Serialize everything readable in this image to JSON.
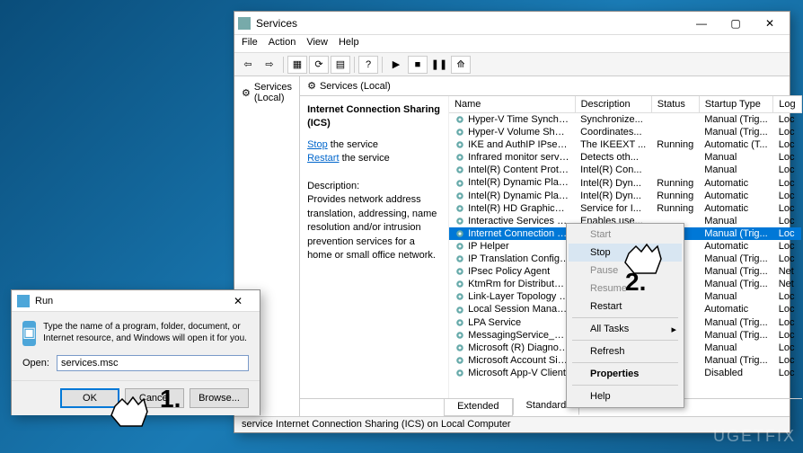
{
  "watermark": "UGETFIX",
  "services_window": {
    "title": "Services",
    "menus": [
      "File",
      "Action",
      "View",
      "Help"
    ],
    "tree_root": "Services (Local)",
    "header": "Services (Local)",
    "detail": {
      "title": "Internet Connection Sharing (ICS)",
      "stop_link": "Stop",
      "stop_rest": " the service",
      "restart_link": "Restart",
      "restart_rest": " the service",
      "desc_label": "Description:",
      "desc_body": "Provides network address translation, addressing, name resolution and/or intrusion prevention services for a home or small office network."
    },
    "columns": [
      "Name",
      "Description",
      "Status",
      "Startup Type",
      "Log"
    ],
    "rows": [
      {
        "name": "Hyper-V Time Synchronizat...",
        "desc": "Synchronize...",
        "status": "",
        "startup": "Manual (Trig...",
        "log": "Loc"
      },
      {
        "name": "Hyper-V Volume Shadow C...",
        "desc": "Coordinates...",
        "status": "",
        "startup": "Manual (Trig...",
        "log": "Loc"
      },
      {
        "name": "IKE and AuthIP IPsec Keying...",
        "desc": "The IKEEXT ...",
        "status": "Running",
        "startup": "Automatic (T...",
        "log": "Loc"
      },
      {
        "name": "Infrared monitor service",
        "desc": "Detects oth...",
        "status": "",
        "startup": "Manual",
        "log": "Loc"
      },
      {
        "name": "Intel(R) Content Protection ...",
        "desc": "Intel(R) Con...",
        "status": "",
        "startup": "Manual",
        "log": "Loc"
      },
      {
        "name": "Intel(R) Dynamic Platform a...",
        "desc": "Intel(R) Dyn...",
        "status": "Running",
        "startup": "Automatic",
        "log": "Loc"
      },
      {
        "name": "Intel(R) Dynamic Platform a...",
        "desc": "Intel(R) Dyn...",
        "status": "Running",
        "startup": "Automatic",
        "log": "Loc"
      },
      {
        "name": "Intel(R) HD Graphics Contro...",
        "desc": "Service for I...",
        "status": "Running",
        "startup": "Automatic",
        "log": "Loc"
      },
      {
        "name": "Interactive Services Detection",
        "desc": "Enables use...",
        "status": "",
        "startup": "Manual",
        "log": "Loc"
      },
      {
        "name": "Internet Connection Shari...",
        "desc": "",
        "status": "",
        "startup": "Manual (Trig...",
        "log": "Loc",
        "selected": true
      },
      {
        "name": "IP Helper",
        "desc": "",
        "status": "",
        "startup": "Automatic",
        "log": "Loc"
      },
      {
        "name": "IP Translation Configurat...",
        "desc": "",
        "status": "",
        "startup": "Manual (Trig...",
        "log": "Loc"
      },
      {
        "name": "IPsec Policy Agent",
        "desc": "",
        "status": "",
        "startup": "Manual (Trig...",
        "log": "Net"
      },
      {
        "name": "KtmRm for Distributed T...",
        "desc": "",
        "status": "",
        "startup": "Manual (Trig...",
        "log": "Net"
      },
      {
        "name": "Link-Layer Topology Dis...",
        "desc": "",
        "status": "",
        "startup": "Manual",
        "log": "Loc"
      },
      {
        "name": "Local Session Manager",
        "desc": "",
        "status": "",
        "startup": "Automatic",
        "log": "Loc"
      },
      {
        "name": "LPA Service",
        "desc": "",
        "status": "",
        "startup": "Manual (Trig...",
        "log": "Loc"
      },
      {
        "name": "MessagingService_42e10...",
        "desc": "",
        "status": "",
        "startup": "Manual (Trig...",
        "log": "Loc"
      },
      {
        "name": "Microsoft (R) Diagnostic...",
        "desc": "",
        "status": "",
        "startup": "Manual",
        "log": "Loc"
      },
      {
        "name": "Microsoft Account Sign...",
        "desc": "",
        "status": "",
        "startup": "Manual (Trig...",
        "log": "Loc"
      },
      {
        "name": "Microsoft App-V Client",
        "desc": "",
        "status": "",
        "startup": "Disabled",
        "log": "Loc"
      }
    ],
    "tabs": [
      "Extended",
      "Standard"
    ],
    "statusbar": "service Internet Connection Sharing (ICS) on Local Computer"
  },
  "context_menu": {
    "items": [
      {
        "label": "Start",
        "disabled": true
      },
      {
        "label": "Stop",
        "hover": true
      },
      {
        "label": "Pause",
        "disabled": true
      },
      {
        "label": "Resume",
        "disabled": true
      },
      {
        "label": "Restart"
      },
      {
        "sep": true
      },
      {
        "label": "All Tasks",
        "arrow": true
      },
      {
        "sep": true
      },
      {
        "label": "Refresh"
      },
      {
        "sep": true
      },
      {
        "label": "Properties",
        "bold": true
      },
      {
        "sep": true
      },
      {
        "label": "Help"
      }
    ]
  },
  "run_dialog": {
    "title": "Run",
    "desc": "Type the name of a program, folder, document, or Internet resource, and Windows will open it for you.",
    "open_label": "Open:",
    "value": "services.msc",
    "ok": "OK",
    "cancel": "Cancel",
    "browse": "Browse..."
  },
  "steps": {
    "one": "1.",
    "two": "2."
  }
}
